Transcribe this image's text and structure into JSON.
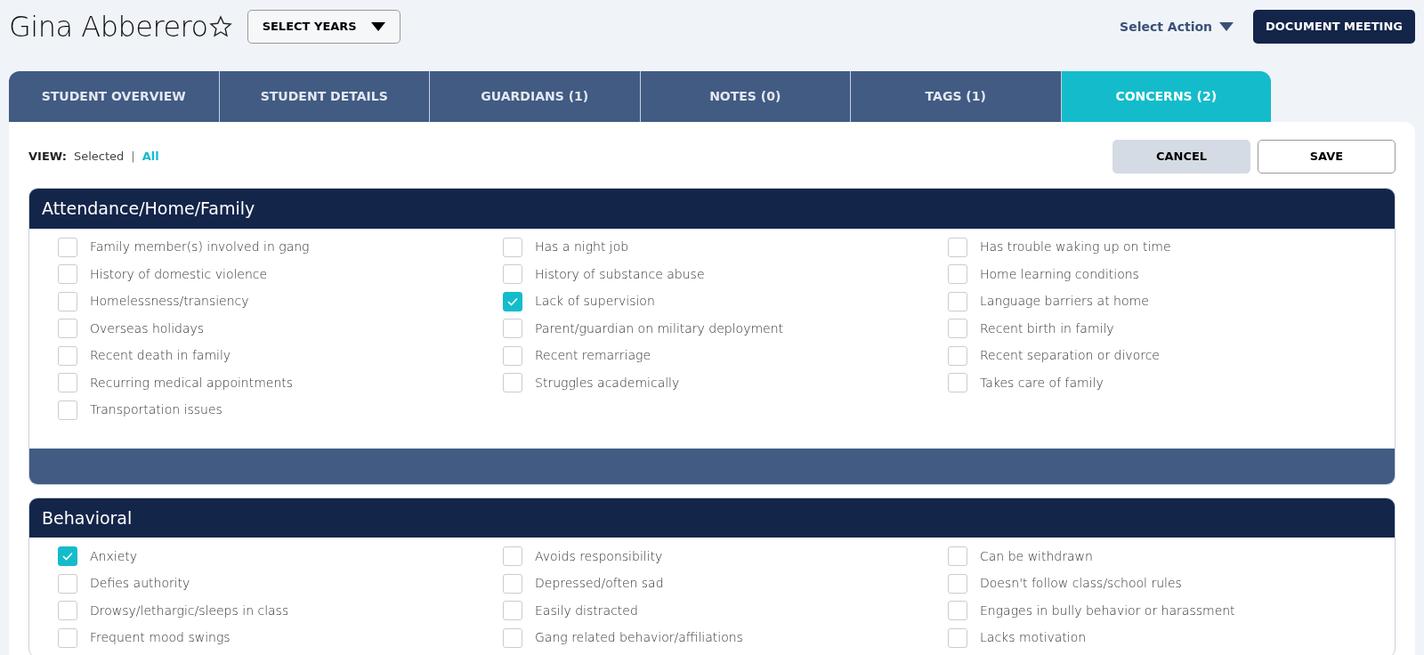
{
  "student": {
    "name": "Gina Abberero",
    "favorite": false
  },
  "select_years": {
    "label": "SELECT YEARS"
  },
  "select_action": {
    "label": "Select Action"
  },
  "document_meeting": {
    "label": "DOCUMENT MEETING"
  },
  "tabs": [
    {
      "label": "STUDENT OVERVIEW",
      "selected": false
    },
    {
      "label": "STUDENT DETAILS",
      "selected": false
    },
    {
      "label": "GUARDIANS (1)",
      "selected": false
    },
    {
      "label": "NOTES (0)",
      "selected": false
    },
    {
      "label": "TAGS (1)",
      "selected": false
    },
    {
      "label": "CONCERNS (2)",
      "selected": true
    }
  ],
  "view": {
    "label": "VIEW:",
    "separator": "|",
    "options": [
      {
        "label": "Selected",
        "selected": false
      },
      {
        "label": "All",
        "selected": true
      }
    ]
  },
  "buttons": [
    {
      "label": "CANCEL",
      "kind": "secondary"
    },
    {
      "label": "SAVE",
      "kind": "outline"
    }
  ],
  "sections": [
    {
      "title": "Attendance/Home/Family",
      "footer": true,
      "items": [
        {
          "label": "Family member(s) involved in gang",
          "checked": false
        },
        {
          "label": "Has a night job",
          "checked": false
        },
        {
          "label": "Has trouble waking up on time",
          "checked": false
        },
        {
          "label": "History of domestic violence",
          "checked": false
        },
        {
          "label": "History of substance abuse",
          "checked": false
        },
        {
          "label": "Home learning conditions",
          "checked": false
        },
        {
          "label": "Homelessness/transiency",
          "checked": false
        },
        {
          "label": "Lack of supervision",
          "checked": true
        },
        {
          "label": "Language barriers at home",
          "checked": false
        },
        {
          "label": "Overseas holidays",
          "checked": false
        },
        {
          "label": "Parent/guardian on military deployment",
          "checked": false
        },
        {
          "label": "Recent birth in family",
          "checked": false
        },
        {
          "label": "Recent death in family",
          "checked": false
        },
        {
          "label": "Recent remarriage",
          "checked": false
        },
        {
          "label": "Recent separation or divorce",
          "checked": false
        },
        {
          "label": "Recurring medical appointments",
          "checked": false
        },
        {
          "label": "Struggles academically",
          "checked": false
        },
        {
          "label": "Takes care of family",
          "checked": false
        },
        {
          "label": "Transportation issues",
          "checked": false
        }
      ]
    },
    {
      "title": "Behavioral",
      "footer": false,
      "items": [
        {
          "label": "Anxiety",
          "checked": true
        },
        {
          "label": "Avoids responsibility",
          "checked": false
        },
        {
          "label": "Can be withdrawn",
          "checked": false
        },
        {
          "label": "Defies authority",
          "checked": false
        },
        {
          "label": "Depressed/often sad",
          "checked": false
        },
        {
          "label": "Doesn't follow class/school rules",
          "checked": false
        },
        {
          "label": "Drowsy/lethargic/sleeps in class",
          "checked": false
        },
        {
          "label": "Easily distracted",
          "checked": false
        },
        {
          "label": "Engages in bully behavior or harassment",
          "checked": false
        },
        {
          "label": "Frequent mood swings",
          "checked": false
        },
        {
          "label": "Gang related behavior/affiliations",
          "checked": false
        },
        {
          "label": "Lacks motivation",
          "checked": false
        }
      ]
    }
  ]
}
